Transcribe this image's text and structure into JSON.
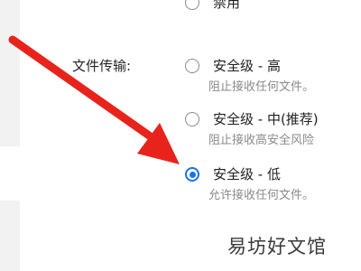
{
  "settings": {
    "file_transfer_label": "文件传输:",
    "options": [
      {
        "title": "禁用",
        "description": "",
        "selected": false
      },
      {
        "title": "安全级 - 高",
        "description": "阻止接收任何文件。",
        "selected": false
      },
      {
        "title": "安全级 - 中(推荐)",
        "description": "阻止接收高安全风险",
        "selected": false
      },
      {
        "title": "安全级 - 低",
        "description": "允许接收任何文件。",
        "selected": true
      }
    ]
  },
  "watermark": "易坊好文馆",
  "colors": {
    "accent": "#1a73e8",
    "annotation_arrow": "#e8231c",
    "description_text": "#8a8a8a",
    "side_panel": "#f2f2f2"
  }
}
